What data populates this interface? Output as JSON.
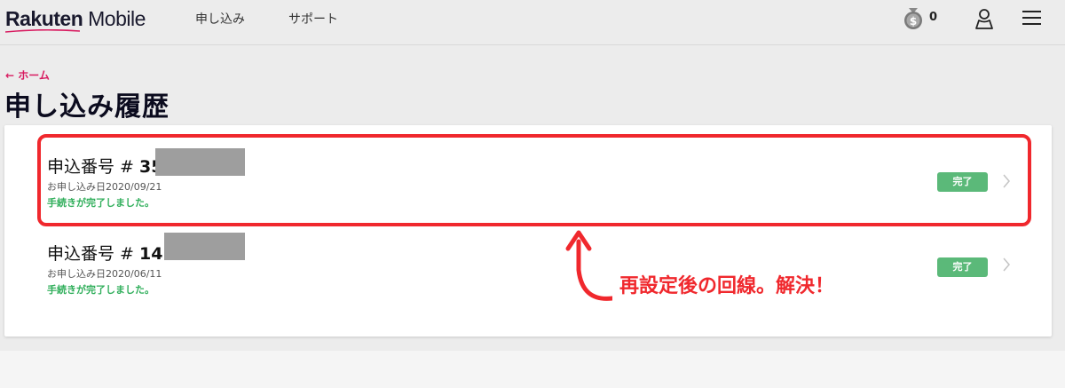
{
  "header": {
    "logo_brand": "Rakuten",
    "logo_sub": " Mobile",
    "nav": [
      "申し込み",
      "サポート"
    ],
    "points_value": "0",
    "icons": [
      "points-coin-icon",
      "user-icon",
      "menu-icon"
    ]
  },
  "breadcrumb": {
    "back_label": "← ホーム"
  },
  "page": {
    "title": "申し込み履歴"
  },
  "orders": [
    {
      "label": "申込番号 # ",
      "number_prefix": "35",
      "date": "お申し込み日2020/09/21",
      "message": "手続きが完了しました。",
      "status": "完了"
    },
    {
      "label": "申込番号 # ",
      "number_prefix": "14",
      "date": "お申し込み日2020/06/11",
      "message": "手続きが完了しました。",
      "status": "完了"
    }
  ],
  "annotation": {
    "text": "再設定後の回線。解決！"
  },
  "colors": {
    "accent_pink": "#d81b60",
    "status_green": "#5bb979",
    "message_green": "#2fae5a",
    "annotation_red": "#f0282d"
  }
}
